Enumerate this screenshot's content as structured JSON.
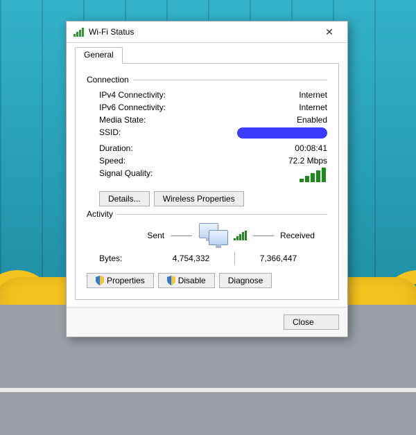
{
  "window": {
    "title": "Wi-Fi Status"
  },
  "tabs": {
    "general": "General"
  },
  "connection": {
    "group_label": "Connection",
    "ipv4_label": "IPv4 Connectivity:",
    "ipv4_value": "Internet",
    "ipv6_label": "IPv6 Connectivity:",
    "ipv6_value": "Internet",
    "media_label": "Media State:",
    "media_value": "Enabled",
    "ssid_label": "SSID:",
    "duration_label": "Duration:",
    "duration_value": "00:08:41",
    "speed_label": "Speed:",
    "speed_value": "72.2 Mbps",
    "signal_label": "Signal Quality:"
  },
  "buttons": {
    "details": "Details...",
    "wireless_properties": "Wireless Properties",
    "properties": "Properties",
    "disable": "Disable",
    "diagnose": "Diagnose",
    "close": "Close"
  },
  "activity": {
    "group_label": "Activity",
    "sent_label": "Sent",
    "received_label": "Received",
    "bytes_label": "Bytes:",
    "bytes_sent": "4,754,332",
    "bytes_received": "7,366,447"
  }
}
